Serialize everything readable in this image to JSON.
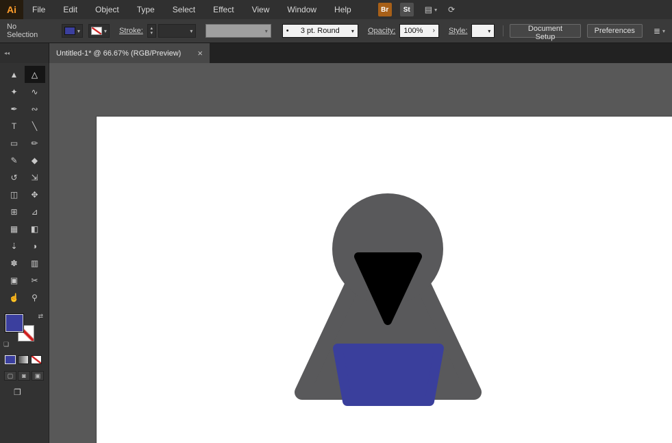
{
  "app": {
    "logo_text": "Ai"
  },
  "menubar": {
    "items": [
      "File",
      "Edit",
      "Object",
      "Type",
      "Select",
      "Effect",
      "View",
      "Window",
      "Help"
    ],
    "bridge_badge": "Br",
    "stock_badge": "St",
    "workspace_icon": "▤",
    "workspace_caret": "▾",
    "touch_icon": "⟳"
  },
  "controlbar": {
    "selection_status": "No Selection",
    "fill_caret": "▾",
    "stroke_caret": "▾",
    "stroke_label": "Stroke:",
    "stepper_up": "▴",
    "stepper_down": "▾",
    "weight_caret": "▾",
    "variable_width_caret": "▾",
    "brush_bullet": "•",
    "brush_value": "3 pt. Round",
    "brush_caret": "▾",
    "opacity_label": "Opacity:",
    "opacity_value": "100%",
    "opacity_chevron": "›",
    "style_label": "Style:",
    "style_caret": "▾",
    "document_setup_button": "Document Setup",
    "preferences_button": "Preferences",
    "align_icon": "≣",
    "align_caret": "▾"
  },
  "tabbar": {
    "collapse_glyph": "◂◂",
    "tab_title": "Untitled-1* @ 66.67% (RGB/Preview)",
    "close_glyph": "×"
  },
  "toolbar": {
    "tools": [
      {
        "name": "selection-tool",
        "glyph": "▲"
      },
      {
        "name": "direct-selection-tool",
        "glyph": "△",
        "active": true
      },
      {
        "name": "magic-wand-tool",
        "glyph": "✦"
      },
      {
        "name": "lasso-tool",
        "glyph": "∿"
      },
      {
        "name": "pen-tool",
        "glyph": "✒"
      },
      {
        "name": "curvature-tool",
        "glyph": "∾"
      },
      {
        "name": "type-tool",
        "glyph": "T"
      },
      {
        "name": "line-segment-tool",
        "glyph": "╲"
      },
      {
        "name": "rectangle-tool",
        "glyph": "▭"
      },
      {
        "name": "paintbrush-tool",
        "glyph": "✏"
      },
      {
        "name": "shaper-tool",
        "glyph": "✎"
      },
      {
        "name": "eraser-tool",
        "glyph": "◆"
      },
      {
        "name": "rotate-tool",
        "glyph": "↺"
      },
      {
        "name": "scale-tool",
        "glyph": "⇲"
      },
      {
        "name": "width-tool",
        "glyph": "◫"
      },
      {
        "name": "free-transform-tool",
        "glyph": "✥"
      },
      {
        "name": "shape-builder-tool",
        "glyph": "⊞"
      },
      {
        "name": "perspective-grid-tool",
        "glyph": "⊿"
      },
      {
        "name": "mesh-tool",
        "glyph": "▦"
      },
      {
        "name": "gradient-tool",
        "glyph": "◧"
      },
      {
        "name": "eyedropper-tool",
        "glyph": "⇣"
      },
      {
        "name": "blend-tool",
        "glyph": "◑"
      },
      {
        "name": "symbol-sprayer-tool",
        "glyph": "✽"
      },
      {
        "name": "column-graph-tool",
        "glyph": "▥"
      },
      {
        "name": "artboard-tool",
        "glyph": "▣"
      },
      {
        "name": "slice-tool",
        "glyph": "✂"
      },
      {
        "name": "hand-tool",
        "glyph": "☝"
      },
      {
        "name": "zoom-tool",
        "glyph": "⚲"
      }
    ],
    "swap_glyph": "⇄",
    "default_swatches_glyph": "❏",
    "draw_modes": [
      {
        "name": "draw-normal-mode-button",
        "glyph": "▢"
      },
      {
        "name": "draw-behind-mode-button",
        "glyph": "◙"
      },
      {
        "name": "draw-inside-mode-button",
        "glyph": "▣"
      }
    ],
    "screen_mode_glyph": "❐"
  },
  "colors": {
    "accent_logo": "#ff9e2c",
    "bridge_badge": "#a86018",
    "stock_badge": "#4f4f4f",
    "fill_swatch": "#3b3f9e",
    "canvas_bg": "#585858",
    "figure_hood": "#59595b",
    "figure_face": "#000000",
    "figure_robe": "#3a3f9c"
  }
}
